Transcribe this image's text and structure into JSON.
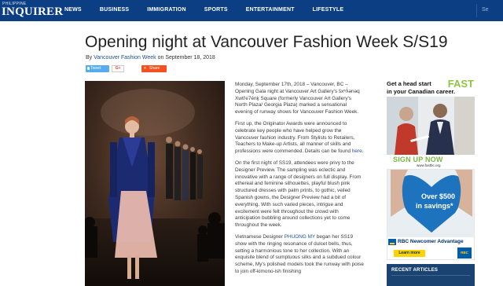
{
  "site": {
    "brand_small": "PHILIPPINE",
    "brand_name": "INQUIRER",
    "nav": [
      "NEWS",
      "BUSINESS",
      "IMMIGRATION",
      "SPORTS",
      "ENTERTAINMENT",
      "LIFESTYLE"
    ],
    "search_placeholder": "Se"
  },
  "article": {
    "title": "Opening night at Vancouver Fashion Week S/S19",
    "byline_prefix": "By",
    "author": "Vancouver Fashion Week",
    "date_prefix": "on",
    "date": "September 18, 2018",
    "share": {
      "tweet": "Tweet",
      "gplus": "G+",
      "share": "Share"
    },
    "paragraphs": [
      "Monday, September 17th, 2018 – Vancouver, BC – Opening Gala night at Vancouver Art Gallery's šxʷƛ̓ənəq Xwtl'e7énḵ Square (formerly Vancouver Art Gallery's North Plaza/ Georgia Plaza) marked a sensational evening of runway shows for Vancouver Fashion Week.",
      "First up, the Originator Awards were announced to celebrate key people who have helped grow the Vancouver fashion industry. From Stylists to Retailers, Teachers to Make-up Artists, all manner of skills and professions were commended. Details can be found",
      "On the first night of SS19, attendees were privy to the Designer Preview. The sampling was eclectic and innovative with a range of designers on full display. From ethereal and feminine silhouettes, playful blush pink structured dresses with palm prints, to gothic, veiled Spanish gowns, the Designer Preview had a bit of everything. With such varied pieces, intrigue and excitement were felt throughout the crowd with anticipation bubbling around collections yet to come throughout the week.",
      "Vietnamese Designer",
      "began her SS19 show with the ringing resonance of dulcet bells, thus, setting a harmonious tone to her collection. With an exquisite blend of sumptuous silks and a subdued colour scheme, My's polished models took the runway with poise to join off-kimono-ish finishing"
    ],
    "here_link": "here",
    "designer_link": "PHUONG MY"
  },
  "ads": {
    "ad1_line1": "Get a head start",
    "ad1_line2": "in your Canadian career.",
    "ad1_brand": "FAST",
    "ad1_cta": "SIGN UP NOW",
    "ad1_url": "www.fastbc.org",
    "ad2_over": "Over $500",
    "ad2_savings": "in savings*",
    "ad2_title": "RBC Newcomer Advantage",
    "ad2_learn": "Learn more",
    "ad2_small": "RBC"
  },
  "sidebar": {
    "recent_title": "RECENT ARTICLES"
  },
  "colors": {
    "nav": "#0b3e83",
    "link": "#1a4f9c",
    "fast_green": "#8dc63f",
    "rbc_blue": "#005daa",
    "rbc_yellow": "#ffd200",
    "share_orange": "#f4511e",
    "twitter": "#55acee"
  }
}
